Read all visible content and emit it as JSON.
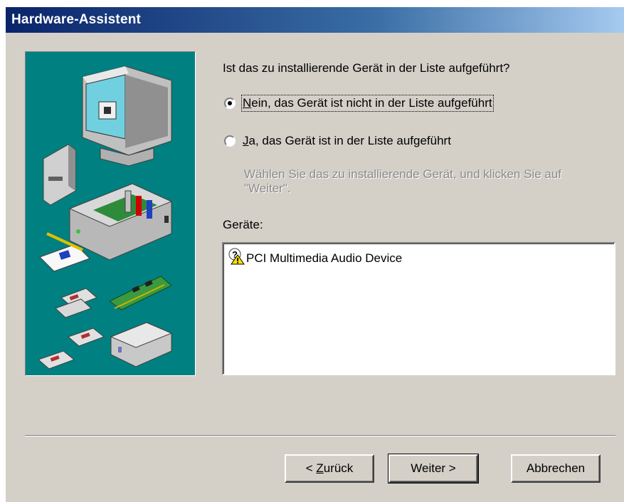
{
  "window": {
    "title": "Hardware-Assistent"
  },
  "question": "Ist das zu installierende Gerät in der Liste aufgeführt?",
  "options": [
    {
      "access_key": "N",
      "label_rest": "ein, das Gerät ist nicht in der Liste aufgeführt",
      "checked": true
    },
    {
      "access_key": "J",
      "label_rest": "a, das Gerät ist in der Liste aufgeführt",
      "checked": false
    }
  ],
  "hint": "Wählen Sie das zu installierende Gerät, und klicken Sie auf \"Weiter\".",
  "devices": {
    "label": "Geräte:",
    "items": [
      {
        "name": "PCI Multimedia Audio Device",
        "icon": "unknown-device-warning-icon"
      }
    ]
  },
  "buttons": {
    "back_prefix": "< ",
    "back_key": "Z",
    "back_rest": "urück",
    "next": "Weiter >",
    "cancel": "Abbrechen"
  },
  "colors": {
    "titlebar_start": "#0a246a",
    "titlebar_end": "#a6caf0",
    "illustration_bg": "#008080",
    "dialog_bg": "#d4d0c8"
  }
}
